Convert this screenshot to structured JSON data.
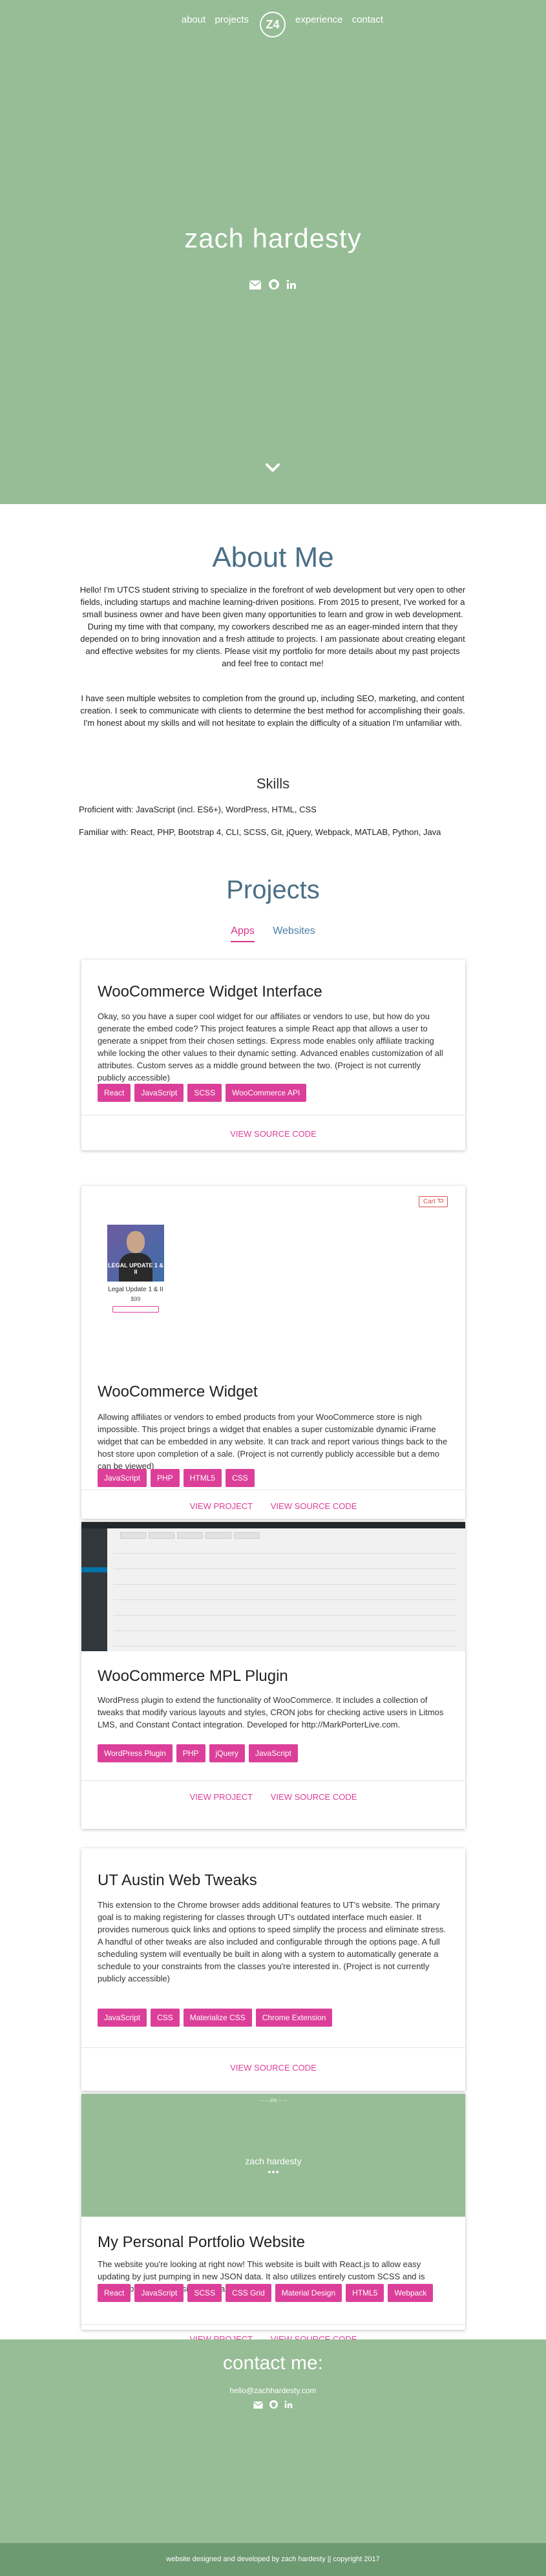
{
  "nav": {
    "left": [
      "about",
      "projects"
    ],
    "logo": "Z4",
    "right": [
      "experience",
      "contact"
    ]
  },
  "hero": {
    "name": "zach hardesty",
    "icons": [
      "envelope-icon",
      "github-icon",
      "linkedin-icon"
    ]
  },
  "about": {
    "title": "About Me",
    "p1": "Hello! I'm UTCS student striving to specialize in the forefront of web development but very open to other fields, including startups and machine learning-driven positions. From 2015 to present, I've worked for a small business owner and have been given many opportunities to learn and grow in web development. During my time with that company, my coworkers described me as an eager-minded intern that they depended on to bring innovation and a fresh attitude to projects. I am passionate about creating elegant and effective websites for my clients. Please visit my portfolio for more details about my past projects and feel free to contact me!",
    "p2": "I have seen multiple websites to completion from the ground up, including SEO, marketing, and content creation. I seek to communicate with clients to determine the best method for accomplishing their goals. I'm honest about my skills and will not hesitate to explain the difficulty of a situation I'm unfamiliar with.",
    "skills_title": "Skills",
    "proficient": "Proficient with: JavaScript (incl. ES6+), WordPress, HTML, CSS",
    "familiar": "Familiar with: React, PHP, Bootstrap 4, CLI, SCSS, Git, jQuery, Webpack, MATLAB, Python, Java"
  },
  "projects": {
    "title": "Projects",
    "tabs": [
      "Apps",
      "Websites"
    ],
    "active_tab": "Apps",
    "cards": [
      {
        "title": "WooCommerce Widget Interface",
        "desc": "Okay, so you have a super cool widget for our affiliates or vendors to use, but how do you generate the embed code? This project features a simple React app that allows a user to generate a snippet from their chosen settings. Express mode enables only affiliate tracking while locking the other values to their dynamic setting. Advanced enables customization of all attributes. Custom serves as a middle ground between the two. (Project is not currently publicly accessible)",
        "tags": [
          "React",
          "JavaScript",
          "SCSS",
          "WooCommerce API"
        ],
        "links": [
          "VIEW SOURCE CODE"
        ]
      },
      {
        "title": "WooCommerce Widget",
        "desc": "Allowing affiliates or vendors to embed products from your WooCommerce store is nigh impossible. This project brings a widget that enables a super customizable dynamic iFrame widget that can be embedded in any website. It can track and report various things back to the host store upon completion of a sale. (Project is not currently publicly accessible but a demo can be viewed)",
        "tags": [
          "JavaScript",
          "PHP",
          "HTML5",
          "CSS"
        ],
        "links": [
          "VIEW PROJECT",
          "VIEW SOURCE CODE"
        ],
        "image": {
          "cart": "Cart",
          "photo_text": "LEGAL UPDATE 1 & II",
          "product": "Legal Update 1 & II",
          "price": "$99"
        }
      },
      {
        "title": "WooCommerce MPL Plugin",
        "desc": "WordPress plugin to extend the functionality of WooCommerce. It includes a collection of tweaks that modify various layouts and styles, CRON jobs for checking active users in Litmos LMS, and Constant Contact integration. Developed for http://MarkPorterLive.com.",
        "tags": [
          "WordPress Plugin",
          "PHP",
          "jQuery",
          "JavaScript"
        ],
        "links": [
          "VIEW PROJECT",
          "VIEW SOURCE CODE"
        ]
      },
      {
        "title": "UT Austin Web Tweaks",
        "desc": "This extension to the Chrome browser adds additional features to UT's website. The primary goal is to making registering for classes through UT's outdated interface much easier. It provides numerous quick links and options to speed simplify the process and eliminate stress. A handful of other tweaks are also included and configurable through the options page. A full scheduling system will eventually be built in along with a system to automatically generate a schedule to your constraints from the classes you're interested in. (Project is not currently publicly accessible)",
        "tags": [
          "JavaScript",
          "CSS",
          "Materialize CSS",
          "Chrome Extension"
        ],
        "links": [
          "VIEW SOURCE CODE"
        ]
      },
      {
        "title": "My Personal Portfolio Website",
        "desc": "The website you're looking at right now! This website is built with React.js to allow easy updating by just pumping in new JSON data. It also utilizes entirely custom SCSS and is inspired by material design standards.",
        "tags": [
          "React",
          "JavaScript",
          "SCSS",
          "CSS Grid",
          "Material Design",
          "HTML5",
          "Webpack"
        ],
        "links": [
          "VIEW PROJECT",
          "VIEW SOURCE CODE"
        ],
        "image": {
          "name": "zach hardesty"
        }
      }
    ]
  },
  "contact": {
    "title": "contact me:",
    "email": "hello@zachhardesty.com",
    "icons": [
      "envelope-icon",
      "github-icon",
      "linkedin-icon"
    ]
  },
  "footer": {
    "text": "website designed and developed by zach hardesty || copyright 2017"
  },
  "colors": {
    "hero_bg": "#96bd96",
    "accent": "#dc3f99",
    "heading": "#4a6f86",
    "footer_bg": "#6e9a72"
  }
}
